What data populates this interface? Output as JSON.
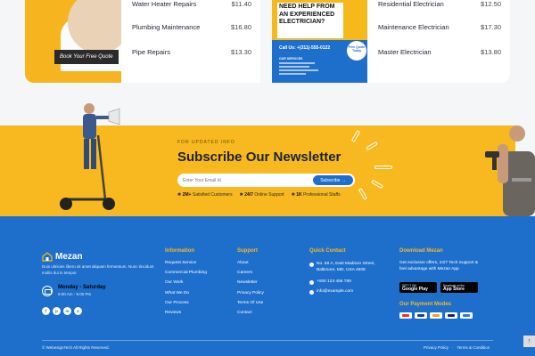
{
  "top": {
    "book_button": "Book Your Free Quote",
    "left_prices": [
      {
        "name": "Water Heater Repairs",
        "price": "$11.40"
      },
      {
        "name": "Plumbing Maintenance",
        "price": "$16.80"
      },
      {
        "name": "Pipe Repairs",
        "price": "$13.30"
      }
    ],
    "right_prices": [
      {
        "name": "Residential Electrician",
        "price": "$12.50"
      },
      {
        "name": "Maintenance Electrician",
        "price": "$17.30"
      },
      {
        "name": "Master Electrician",
        "price": "$13.80"
      }
    ],
    "promo": {
      "title": "NEED HELP FROM AN EXPERIENCED ELECTRICIAN?",
      "call": "Call Us: +(311)-555-0122",
      "badge": "Free Quote Today",
      "services_label": "OUR SERVICES"
    }
  },
  "subscribe": {
    "eyebrow": "FOR UPDATED INFO",
    "title": "Subscribe Our Newsletter",
    "input_placeholder": "Enter Your Email Id",
    "button": "Subscribe →",
    "stats": [
      {
        "value": "2M+",
        "label": "Satisfied Customers"
      },
      {
        "value": "24/7",
        "label": "Online Support"
      },
      {
        "value": "1K",
        "label": "Professional Staffs"
      }
    ]
  },
  "footer": {
    "brand": "Mezan",
    "description": "Duis ultricies libero sit amet aliquam fermentum. Nunc tincidunt mollis dui in tempor.",
    "hours_title": "Monday - Saturday",
    "hours_time": "9.00 Am - 9.00 Pm",
    "socials": [
      "f",
      "p",
      "in",
      "x"
    ],
    "information": {
      "heading": "Information",
      "links": [
        "Request Service",
        "Commercial Plumbing",
        "Our Work",
        "What We Do",
        "Our Process",
        "Reviews"
      ]
    },
    "support": {
      "heading": "Support",
      "links": [
        "About",
        "Careers",
        "Newsletter",
        "Privacy Policy",
        "Terms Of Use",
        "Contact"
      ]
    },
    "quick_contact": {
      "heading": "Quick Contact",
      "address_line1": "No. 58 A, East Madison Street,",
      "address_line2": "Baltimore, MD, USA 4508",
      "phone": "+000 123 456 789",
      "email": "info@example.com"
    },
    "download": {
      "heading": "Download Mezan",
      "text": "Get exclusive offers, 24/7 Tech Support & feel advantage with Mezan App",
      "google_small": "GET IT ON",
      "google_big": "Google Play",
      "apple_small": "Download on the",
      "apple_big": "App Store"
    },
    "payment_heading": "Our Payment Modes",
    "payment_colors": [
      "#e4362f",
      "#1a3d8f",
      "#f79e1b",
      "#1a1f71",
      "#2a7bd6"
    ],
    "copyright": "© WebesignTech All Rights Reserved.",
    "legal": [
      "Privacy Policy",
      "·",
      "Terms & Condition"
    ],
    "scroll_top": "↑"
  },
  "colors": {
    "accent_yellow": "#f7b91f",
    "brand_blue": "#1e6fcc"
  }
}
